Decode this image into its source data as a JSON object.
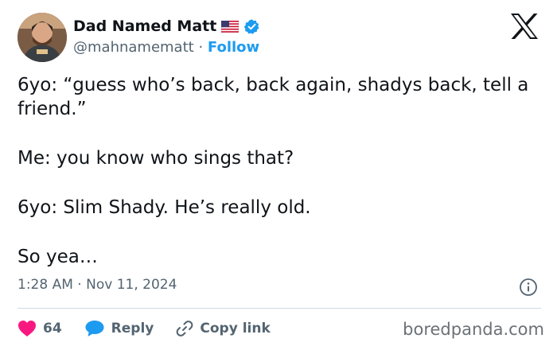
{
  "author": {
    "display_name": "Dad Named Matt",
    "handle": "@mahnamematt",
    "separator": "·",
    "follow_label": "Follow"
  },
  "tweet": {
    "lines": [
      "6yo: “guess who’s back, back again, shadys back, tell a friend.”",
      "Me: you know who sings that?",
      "6yo: Slim Shady. He’s really old.",
      "So yea…"
    ],
    "time": "1:28 AM",
    "separator": "·",
    "date": "Nov 11, 2024"
  },
  "actions": {
    "likes_count": "64",
    "reply_label": "Reply",
    "copy_link_label": "Copy link"
  },
  "watermark": "boredpanda.com",
  "icons": [
    "avatar",
    "us-flag-icon",
    "verified-badge-icon",
    "x-logo-icon",
    "info-icon",
    "heart-icon",
    "reply-icon",
    "link-icon"
  ],
  "colors": {
    "accent": "#1d9bf0",
    "text": "#0f1419",
    "muted": "#536471",
    "heart": "#f91880",
    "divider": "#cfd9de"
  }
}
